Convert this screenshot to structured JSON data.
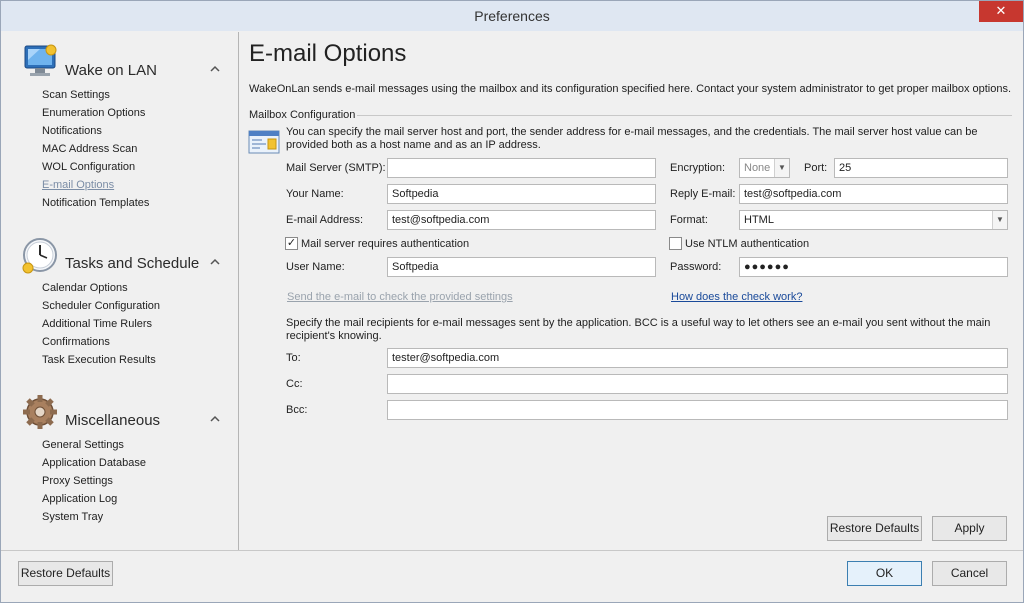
{
  "window": {
    "title": "Preferences",
    "close_glyph": "✕"
  },
  "sidebar": {
    "sections": [
      {
        "title": "Wake on LAN",
        "icon": "monitor-icon",
        "items": [
          "Scan Settings",
          "Enumeration Options",
          "Notifications",
          "MAC Address Scan",
          "WOL Configuration",
          "E-mail Options",
          "Notification Templates"
        ]
      },
      {
        "title": "Tasks and Schedule",
        "icon": "clock-icon",
        "items": [
          "Calendar Options",
          "Scheduler Configuration",
          "Additional Time Rulers",
          "Confirmations",
          "Task Execution Results"
        ]
      },
      {
        "title": "Miscellaneous",
        "icon": "gear-icon",
        "items": [
          "General Settings",
          "Application Database",
          "Proxy Settings",
          "Application Log",
          "System Tray"
        ]
      }
    ],
    "active_item": "E-mail Options"
  },
  "main": {
    "title": "E-mail Options",
    "description": "WakeOnLan sends e-mail messages using the mailbox and its configuration specified here. Contact your system administrator to get proper mailbox options.",
    "group_label": "Mailbox Configuration",
    "info_text": "You can specify the mail server host and port, the sender address for e-mail messages, and the credentials. The mail server host value can be provided both as a host name and as an IP address.",
    "fields": {
      "mail_server_label": "Mail Server (SMTP):",
      "mail_server_value": "",
      "encryption_label": "Encryption:",
      "encryption_value": "None",
      "port_label": "Port:",
      "port_value": "25",
      "your_name_label": "Your Name:",
      "your_name_value": "Softpedia",
      "reply_email_label": "Reply E-mail:",
      "reply_email_value": "test@softpedia.com",
      "email_address_label": "E-mail Address:",
      "email_address_value": "test@softpedia.com",
      "format_label": "Format:",
      "format_value": "HTML",
      "requires_auth_label": "Mail server requires authentication",
      "requires_auth_checked": true,
      "ntlm_label": "Use NTLM authentication",
      "ntlm_checked": false,
      "user_name_label": "User Name:",
      "user_name_value": "Softpedia",
      "password_label": "Password:",
      "password_value": "●●●●●●"
    },
    "send_test_link": "Send the e-mail to check the provided settings",
    "how_check_link": "How does the check work?",
    "recipients_text": "Specify the mail recipients for e-mail messages sent by the application. BCC is a useful way to let others see an e-mail you sent without the main recipient's knowing.",
    "recipients": {
      "to_label": "To:",
      "to_value": "tester@softpedia.com",
      "cc_label": "Cc:",
      "cc_value": "",
      "bcc_label": "Bcc:",
      "bcc_value": ""
    },
    "restore_defaults_label": "Restore Defaults",
    "apply_label": "Apply"
  },
  "footer": {
    "restore_defaults_label": "Restore Defaults",
    "ok_label": "OK",
    "cancel_label": "Cancel"
  },
  "colors": {
    "accent": "#3c7fb1",
    "close": "#c7372f",
    "active_link": "#1a4a9a",
    "disabled_link": "#9aa3ad"
  }
}
